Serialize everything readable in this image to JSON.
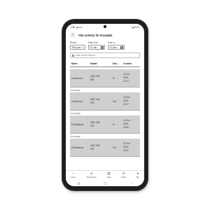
{
  "status_bar": {
    "time": "2:50",
    "extra": "◆ ◘ ●",
    "battery": "▾◢ 87%"
  },
  "header": {
    "back_symbol": "‹",
    "title": "Site activity for Example"
  },
  "filters": {
    "period_label": "Period",
    "period_value": "This year",
    "date_from_label": "Date from",
    "date_from_value": "01-Jan...",
    "date_to_label": "Date to",
    "date_to_value": "31-Dec..."
  },
  "search": {
    "placeholder": "Enter text to search..."
  },
  "table": {
    "columns": [
      "Name",
      "Mobile",
      "Dire...",
      "Created"
    ],
    "rows": [
      {
        "site": "",
        "name": "A Anderson",
        "mobile_1": "0452 345",
        "mobile_2": "678",
        "direction": "In",
        "created_1": "12-Jun",
        "created_2": "2024",
        "created_3": "14:27"
      },
      {
        "site": "Southgate",
        "name": "A Anderson",
        "mobile_1": "0452 345",
        "mobile_2": "678",
        "direction": "Out",
        "created_1": "12-Jun",
        "created_2": "2024",
        "created_3": "14:27"
      },
      {
        "site": "Southgate",
        "name": "B Bradshaw",
        "mobile_1": "0452 345",
        "mobile_2": "678",
        "direction": "In",
        "created_1": "12-Jun",
        "created_2": "2024",
        "created_3": "14:32"
      },
      {
        "site": "Southgate",
        "name": "B Bradshaw",
        "mobile_1": "0452 345",
        "mobile_2": "678",
        "direction": "Out",
        "created_1": "12-Jun",
        "created_2": "2024",
        "created_3": "14:32"
      }
    ]
  },
  "bottom_nav": [
    {
      "label": "Home",
      "icon": "home-icon",
      "glyph": "⌂"
    },
    {
      "label": "Timesheets",
      "icon": "clock-icon",
      "glyph": "◷"
    },
    {
      "label": "Jobs",
      "icon": "clipboard-icon",
      "glyph": "▤"
    },
    {
      "label": "Tasks",
      "icon": "checklist-icon",
      "glyph": "☑"
    },
    {
      "label": "Me",
      "icon": "person-icon",
      "glyph": "●"
    }
  ],
  "android_nav": {
    "recent": "|||",
    "home": "◯",
    "back": "‹"
  },
  "colors": {
    "accent": "#1f47a8",
    "row_bg": "#cfcfcf"
  }
}
